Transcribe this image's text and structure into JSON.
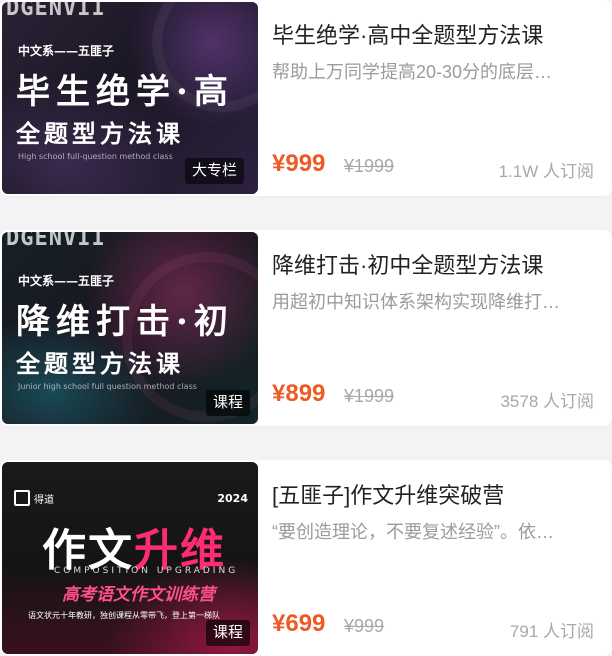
{
  "courses": [
    {
      "thumb": {
        "top_deco": "DGENVII",
        "series": "中文系——五匪子",
        "line1": "毕生绝学·高",
        "line2": "全题型方法课",
        "english": "High school full-question method class",
        "badge": "大专栏"
      },
      "title": "毕生绝学·高中全题型方法课",
      "description": "帮助上万同学提高20-30分的底层…",
      "price": "¥999",
      "original_price": "¥1999",
      "subscribers": "1.1W 人订阅"
    },
    {
      "thumb": {
        "top_deco": "DGENVII",
        "series": "中文系——五匪子",
        "line1": "降维打击·初",
        "line2": "全题型方法课",
        "english": "Junior high school full question method class",
        "badge": "课程"
      },
      "title": "降维打击·初中全题型方法课",
      "description": "用超初中知识体系架构实现降维打…",
      "price": "¥899",
      "original_price": "¥1999",
      "subscribers": "3578 人订阅"
    },
    {
      "thumb": {
        "logo": "得道",
        "year": "2024",
        "big_white": "作文",
        "big_pink": "升维",
        "english": "COMPOSITION UPGRADING",
        "tagline": "高考语文作文训练营",
        "small_text": "语文状元十年教研，独创课程从零带飞，登上第一梯队",
        "badge": "课程"
      },
      "title": "[五匪子]作文升维突破营",
      "description": "“要创造理论，不要复述经验”。依…",
      "price": "¥699",
      "original_price": "¥999",
      "subscribers": "791 人订阅"
    }
  ],
  "colors": {
    "price": "#ee5a24",
    "muted": "#a8a8a8",
    "title": "#222222",
    "accent_pink": "#ff2d6f"
  }
}
